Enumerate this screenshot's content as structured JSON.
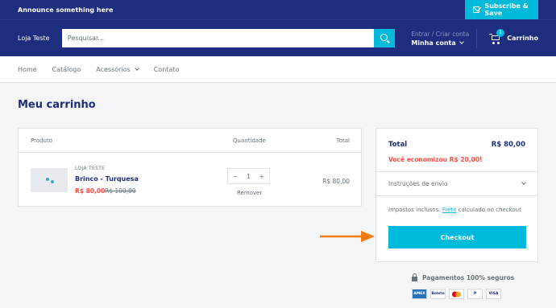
{
  "announcement": {
    "text": "Announce something here",
    "subscribe_label": "Subscribe & Save"
  },
  "header": {
    "logo": "Loja Teste",
    "search_placeholder": "Pesquisar...",
    "account_small": "Entrar / Criar conta",
    "account_main": "Minha conta",
    "cart_label": "Carrinho",
    "cart_count": "1"
  },
  "nav": {
    "items": [
      "Home",
      "Catálogo",
      "Acessórios",
      "Contato"
    ]
  },
  "page": {
    "title": "Meu carrinho"
  },
  "cart_table": {
    "headers": {
      "product": "Produto",
      "quantity": "Quantidade",
      "total": "Total"
    },
    "item": {
      "vendor": "LOJA TESTE",
      "name": "Brinco - Turquesa",
      "price": "R$ 80,00",
      "compare_price": "R$ 100,00",
      "quantity": "1",
      "remove_label": "Remover",
      "line_total": "R$ 80,00"
    }
  },
  "summary": {
    "total_label": "Total",
    "total_value": "R$ 80,00",
    "savings": "Você economizou R$ 20,00!",
    "instructions": "Instruções de envio",
    "taxes_prefix": "Impostos inclusos.",
    "taxes_link": "Frete",
    "taxes_suffix": "calculado no checkout",
    "checkout": "Checkout"
  },
  "secure": {
    "text": "Pagamentos 100% seguros"
  },
  "payment_methods": [
    "AMEX",
    "Boleto",
    "Mastercard",
    "PayPal",
    "VISA"
  ],
  "colors": {
    "primary": "#1e2d7d",
    "accent": "#00badb",
    "sale": "#f94c43",
    "arrow": "#f37a10"
  }
}
